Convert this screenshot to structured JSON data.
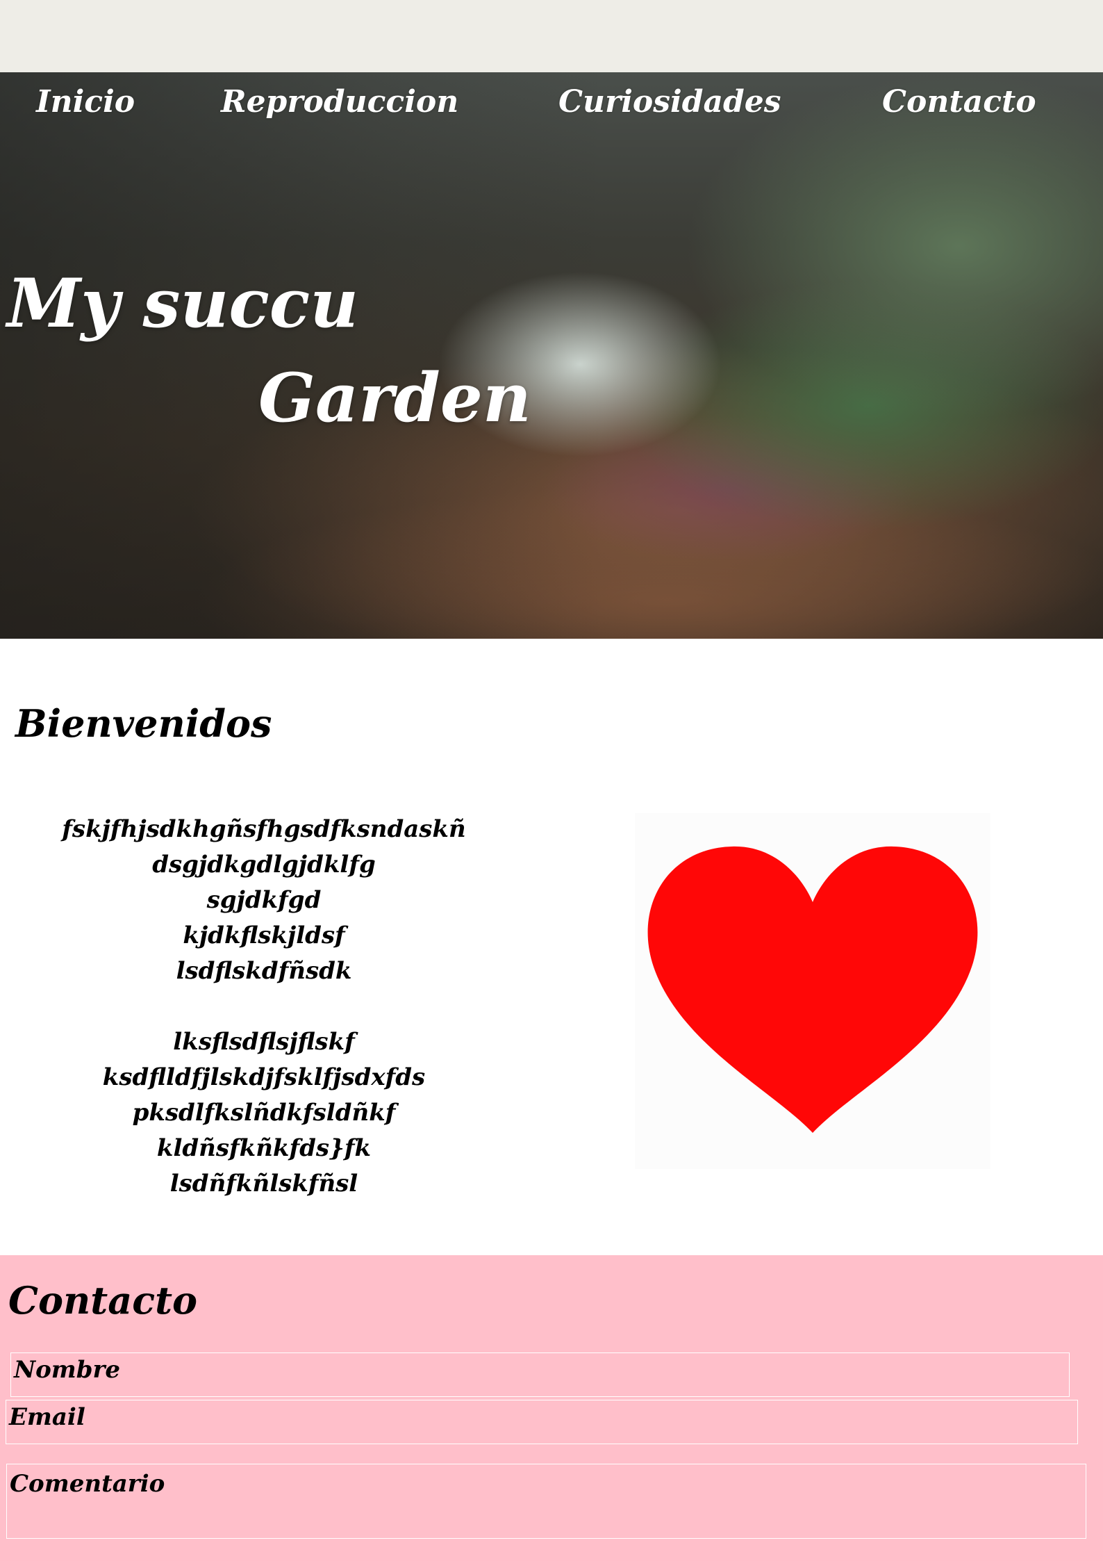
{
  "nav": {
    "items": [
      {
        "label": "Inicio"
      },
      {
        "label": "Reproduccion"
      },
      {
        "label": "Curiosidades"
      },
      {
        "label": "Contacto"
      }
    ]
  },
  "hero": {
    "title_line1": "My succu",
    "title_line2": "Garden"
  },
  "welcome": {
    "heading": "Bienvenidos",
    "paragraph1": [
      "fskjfhjsdkhgñsfhgsdfksndaskñ",
      "dsgjdkgdlgjdklfg",
      "sgjdkfgd",
      "kjdkflskjldsf",
      "lsdflskdfñsdk"
    ],
    "paragraph2": [
      "lksflsdflsjflskf",
      "ksdflldfjlskdjfsklfjsdxfds",
      "pksdlfkslñdkfsldñkf",
      "kldñsfkñkfds}fk",
      "lsdñfkñlskfñsl"
    ],
    "image_icon": "heart-icon",
    "heart_color": "#ff0707"
  },
  "contact": {
    "heading": "Contacto",
    "fields": {
      "name_label": "Nombre",
      "email_label": "Email",
      "comment_label": "Comentario"
    },
    "background_color": "#ffbfca"
  }
}
